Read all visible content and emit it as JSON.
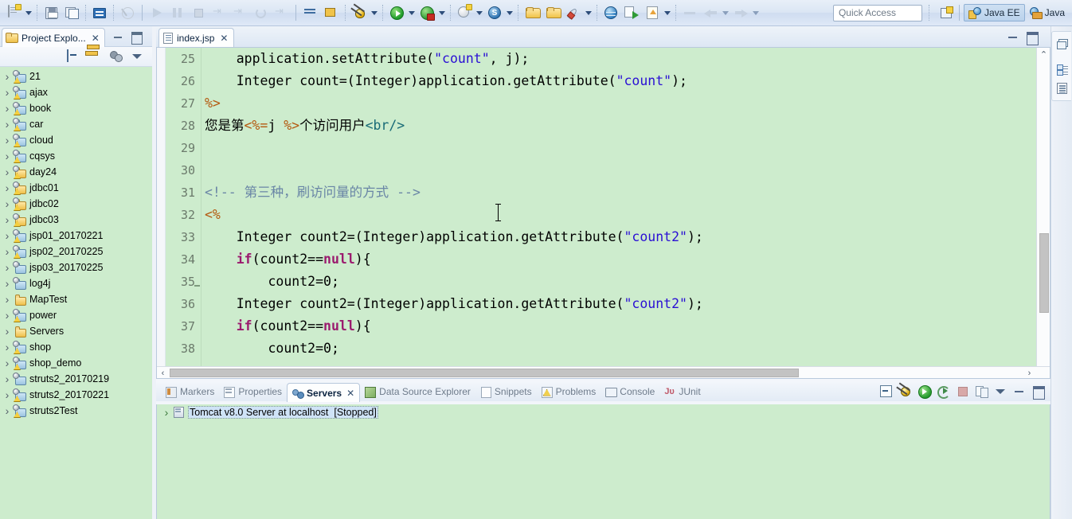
{
  "toolbar": {
    "items": [
      {
        "name": "new-wizard-icon",
        "label": "New"
      },
      {
        "name": "new-dropdown-arrow",
        "label": ""
      },
      {
        "name": "save-icon",
        "label": "Save"
      },
      {
        "name": "save-all-icon",
        "label": "Save All"
      },
      {
        "name": "console-icon",
        "label": "Open Console"
      },
      {
        "name": "disable-breakpoints-icon",
        "label": "Skip All Breakpoints"
      },
      {
        "name": "resume-icon",
        "label": "Resume"
      },
      {
        "name": "suspend-icon",
        "label": "Suspend"
      },
      {
        "name": "terminate-icon",
        "label": "Terminate"
      },
      {
        "name": "step-into-icon",
        "label": "Step Into"
      },
      {
        "name": "step-over-icon",
        "label": "Step Over"
      },
      {
        "name": "step-return-icon",
        "label": "Step Return"
      },
      {
        "name": "drop-to-frame-icon",
        "label": "Drop To Frame"
      },
      {
        "name": "next-annotation-icon",
        "label": "Next Annotation"
      },
      {
        "name": "previous-annotation-icon",
        "label": "Previous Annotation"
      },
      {
        "name": "debug-icon",
        "label": "Debug"
      },
      {
        "name": "debug-dropdown-arrow",
        "label": ""
      },
      {
        "name": "run-icon",
        "label": "Run"
      },
      {
        "name": "run-dropdown-arrow",
        "label": ""
      },
      {
        "name": "run-as-server-icon",
        "label": "Run As Server"
      },
      {
        "name": "run-server-dropdown-arrow",
        "label": ""
      },
      {
        "name": "coverage-icon",
        "label": "Coverage"
      },
      {
        "name": "coverage-dropdown-arrow",
        "label": ""
      },
      {
        "name": "svn-icon",
        "label": "SVN"
      },
      {
        "name": "svn-dropdown-arrow",
        "label": ""
      },
      {
        "name": "new-folder-icon",
        "label": "New Folder"
      },
      {
        "name": "open-folder-icon",
        "label": "Open Folder"
      },
      {
        "name": "external-tools-icon",
        "label": "External Tools"
      },
      {
        "name": "external-tools-dropdown-arrow",
        "label": ""
      },
      {
        "name": "web-browser-icon",
        "label": "Web Browser"
      },
      {
        "name": "deploy-icon",
        "label": "Deploy"
      },
      {
        "name": "download-icon",
        "label": "Download"
      },
      {
        "name": "download-dropdown-arrow",
        "label": ""
      },
      {
        "name": "search-icon",
        "label": "Search"
      },
      {
        "name": "search-dropdown-arrow",
        "label": ""
      },
      {
        "name": "last-edit-location-icon",
        "label": "Last Edit Location"
      },
      {
        "name": "back-icon",
        "label": "Back"
      },
      {
        "name": "back-dropdown-arrow",
        "label": ""
      },
      {
        "name": "forward-icon",
        "label": "Forward"
      },
      {
        "name": "forward-dropdown-arrow",
        "label": ""
      }
    ],
    "quick_access": "Quick Access",
    "perspectives": [
      {
        "label": "Java EE",
        "active": true,
        "icon": "java-ee-perspective-icon"
      },
      {
        "label": "Java",
        "active": false,
        "icon": "java-perspective-icon"
      }
    ],
    "open_perspective_tooltip": "Open Perspective"
  },
  "project_explorer": {
    "tab_title": "Project Explo...",
    "tab_close": "✕",
    "toolbar": [
      {
        "name": "collapse-all-icon",
        "label": "Collapse All"
      },
      {
        "name": "link-with-editor-icon",
        "label": "Link with Editor"
      },
      {
        "name": "filters-icon",
        "label": "Filters"
      },
      {
        "name": "view-menu-icon",
        "label": "View Menu"
      }
    ],
    "minimize_label": "Minimize",
    "maximize_label": "Maximize",
    "tree": [
      {
        "label": "21",
        "type": "project-warning"
      },
      {
        "label": "ajax",
        "type": "project-warning"
      },
      {
        "label": "book",
        "type": "project-warning"
      },
      {
        "label": "car",
        "type": "project-warning"
      },
      {
        "label": "cloud",
        "type": "project-warning"
      },
      {
        "label": "cqsys",
        "type": "project-warning"
      },
      {
        "label": "day24",
        "type": "project-warning-plain"
      },
      {
        "label": "jdbc01",
        "type": "project-warning-plain"
      },
      {
        "label": "jdbc02",
        "type": "project-warning-plain"
      },
      {
        "label": "jdbc03",
        "type": "project-warning-plain"
      },
      {
        "label": "jsp01_20170221",
        "type": "project-warning"
      },
      {
        "label": "jsp02_20170225",
        "type": "project-warning"
      },
      {
        "label": "jsp03_20170225",
        "type": "project"
      },
      {
        "label": "log4j",
        "type": "project"
      },
      {
        "label": "MapTest",
        "type": "folder"
      },
      {
        "label": "power",
        "type": "project-warning"
      },
      {
        "label": "Servers",
        "type": "folder"
      },
      {
        "label": "shop",
        "type": "project-warning"
      },
      {
        "label": "shop_demo",
        "type": "project-warning"
      },
      {
        "label": "struts2_20170219",
        "type": "project"
      },
      {
        "label": "struts2_20170221",
        "type": "project-warning"
      },
      {
        "label": "struts2Test",
        "type": "project-warning"
      }
    ]
  },
  "editor": {
    "tab_title": "index.jsp",
    "tab_close": "✕",
    "minimize_label": "Minimize",
    "maximize_label": "Maximize",
    "first_line_number": 25,
    "lines": [
      {
        "num": 25,
        "fold": false,
        "segments": [
          {
            "t": "    application.setAttribute(",
            "c": "plain"
          },
          {
            "t": "\"count\"",
            "c": "k-str"
          },
          {
            "t": ", j);",
            "c": "plain"
          }
        ]
      },
      {
        "num": 26,
        "fold": false,
        "segments": [
          {
            "t": "    Integer count=(Integer)application.getAttribute(",
            "c": "plain"
          },
          {
            "t": "\"count\"",
            "c": "k-str"
          },
          {
            "t": ");",
            "c": "plain"
          }
        ]
      },
      {
        "num": 27,
        "fold": false,
        "segments": [
          {
            "t": "%>",
            "c": "k-scriptlet"
          }
        ]
      },
      {
        "num": 28,
        "fold": false,
        "segments": [
          {
            "t": "您是第",
            "c": "plain"
          },
          {
            "t": "<%=",
            "c": "k-scriptlet"
          },
          {
            "t": "j ",
            "c": "plain"
          },
          {
            "t": "%>",
            "c": "k-scriptlet"
          },
          {
            "t": "个访问用户",
            "c": "plain"
          },
          {
            "t": "<br/>",
            "c": "k-html"
          }
        ]
      },
      {
        "num": 29,
        "fold": false,
        "segments": [
          {
            "t": "",
            "c": "plain"
          }
        ]
      },
      {
        "num": 30,
        "fold": false,
        "segments": [
          {
            "t": "",
            "c": "plain"
          }
        ]
      },
      {
        "num": 31,
        "fold": false,
        "segments": [
          {
            "t": "<!-- 第三种，刷访问量的方式 -->",
            "c": "k-cmt"
          }
        ]
      },
      {
        "num": 32,
        "fold": false,
        "segments": [
          {
            "t": "<%",
            "c": "k-scriptlet"
          }
        ]
      },
      {
        "num": 33,
        "fold": false,
        "segments": [
          {
            "t": "    Integer count2=(Integer)application.getAttribute(",
            "c": "plain"
          },
          {
            "t": "\"count2\"",
            "c": "k-str"
          },
          {
            "t": ");",
            "c": "plain"
          }
        ]
      },
      {
        "num": 34,
        "fold": false,
        "segments": [
          {
            "t": "    ",
            "c": "plain"
          },
          {
            "t": "if",
            "c": "k-kw"
          },
          {
            "t": "(count2==",
            "c": "plain"
          },
          {
            "t": "null",
            "c": "k-kw"
          },
          {
            "t": "){",
            "c": "plain"
          }
        ]
      },
      {
        "num": 35,
        "fold": true,
        "segments": [
          {
            "t": "        count2=0;",
            "c": "plain"
          }
        ]
      },
      {
        "num": 36,
        "fold": false,
        "segments": [
          {
            "t": "    Integer count2=(Integer)application.getAttribute(",
            "c": "plain"
          },
          {
            "t": "\"count2\"",
            "c": "k-str"
          },
          {
            "t": ");",
            "c": "plain"
          }
        ]
      },
      {
        "num": 37,
        "fold": false,
        "segments": [
          {
            "t": "    ",
            "c": "plain"
          },
          {
            "t": "if",
            "c": "k-kw"
          },
          {
            "t": "(count2==",
            "c": "plain"
          },
          {
            "t": "null",
            "c": "k-kw"
          },
          {
            "t": "){",
            "c": "plain"
          }
        ]
      },
      {
        "num": 38,
        "fold": false,
        "segments": [
          {
            "t": "        count2=0;",
            "c": "plain"
          }
        ]
      }
    ],
    "scroll_up": "⌃",
    "scroll_down": "⌄",
    "scroll_left": "‹",
    "scroll_right": "›"
  },
  "bottom_panel": {
    "tabs": [
      {
        "label": "Markers",
        "icon": "markers-icon",
        "active": false,
        "close": ""
      },
      {
        "label": "Properties",
        "icon": "properties-icon",
        "active": false,
        "close": ""
      },
      {
        "label": "Servers",
        "icon": "servers-icon",
        "active": true,
        "close": "✕"
      },
      {
        "label": "Data Source Explorer",
        "icon": "data-source-explorer-icon",
        "active": false,
        "close": ""
      },
      {
        "label": "Snippets",
        "icon": "snippets-icon",
        "active": false,
        "close": ""
      },
      {
        "label": "Problems",
        "icon": "problems-icon",
        "active": false,
        "close": ""
      },
      {
        "label": "Console",
        "icon": "console-icon",
        "active": false,
        "close": ""
      },
      {
        "label": "JUnit",
        "icon": "junit-icon",
        "active": false,
        "close": ""
      }
    ],
    "tools": [
      {
        "name": "collapse-all-icon",
        "label": "Collapse All"
      },
      {
        "name": "debug-server-icon",
        "label": "Start the server in debug mode"
      },
      {
        "name": "start-server-icon",
        "label": "Start the server"
      },
      {
        "name": "profile-server-icon",
        "label": "Start the server in profiling mode"
      },
      {
        "name": "stop-server-icon",
        "label": "Stop the server"
      },
      {
        "name": "publish-icon",
        "label": "Publish to the server"
      },
      {
        "name": "view-menu-icon",
        "label": "View Menu"
      },
      {
        "name": "minimize-icon",
        "label": "Minimize"
      },
      {
        "name": "maximize-icon",
        "label": "Maximize"
      }
    ],
    "server_row": {
      "name": "Tomcat v8.0 Server at localhost",
      "status": "[Stopped]",
      "expander": "›"
    }
  },
  "right_bar": {
    "items": [
      {
        "name": "restore-icon",
        "label": "Restore"
      },
      {
        "name": "outline-view-icon",
        "label": "Outline"
      },
      {
        "name": "snippets-view-icon",
        "label": "Snippets"
      }
    ]
  }
}
